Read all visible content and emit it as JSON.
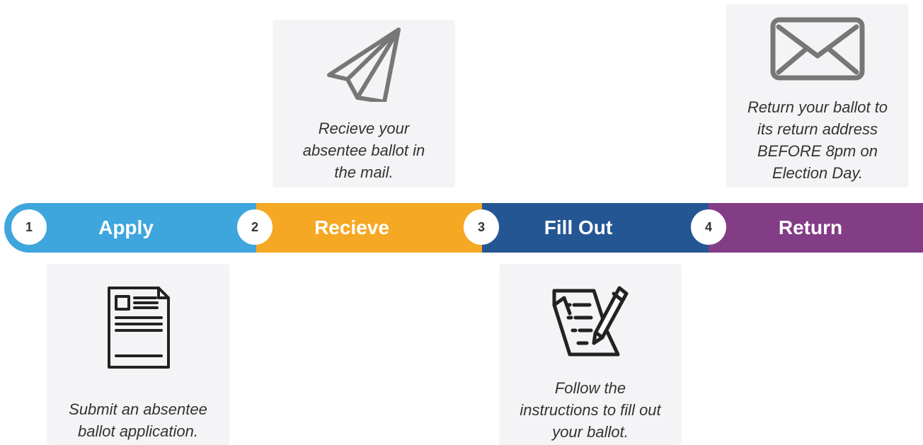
{
  "steps": [
    {
      "number": "1",
      "label": "Apply",
      "color": "#3ea6dd",
      "icon": "document-icon",
      "description": "Submit an absentee ballot application."
    },
    {
      "number": "2",
      "label": "Recieve",
      "color": "#f5a823",
      "icon": "paper-plane-icon",
      "description": "Recieve your absentee ballot in the mail."
    },
    {
      "number": "3",
      "label": "Fill Out",
      "color": "#245694",
      "icon": "writing-icon",
      "description": "Follow the instructions to fill out your ballot."
    },
    {
      "number": "4",
      "label": "Return",
      "color": "#833d86",
      "icon": "envelope-icon",
      "description": "Return your ballot to its return address BEFORE 8pm on Election Day."
    }
  ],
  "card_lines": {
    "apply": [
      "Submit an absentee",
      "ballot application."
    ],
    "recieve": [
      "Recieve your",
      "absentee ballot in",
      "the mail."
    ],
    "fill_out": [
      "Follow the",
      "instructions to fill out",
      "your ballot."
    ],
    "return": [
      "Return your ballot to",
      "its return address",
      "BEFORE 8pm on",
      "Election Day."
    ]
  }
}
